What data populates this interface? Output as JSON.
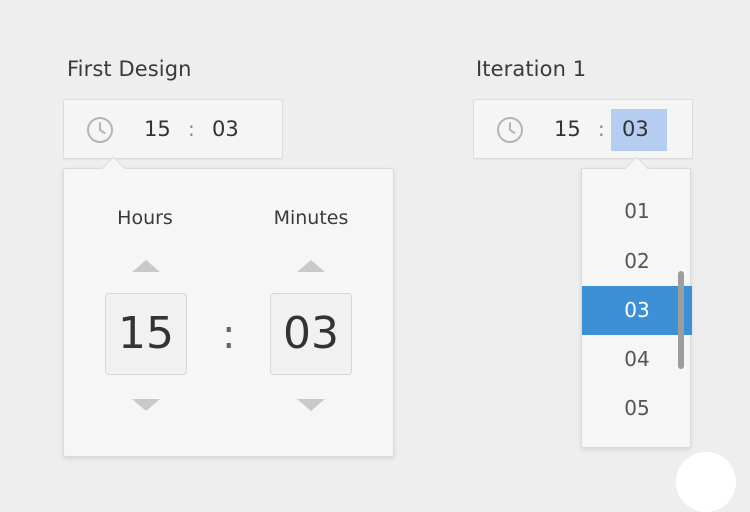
{
  "first_design": {
    "title": "First Design",
    "field": {
      "hours": "15",
      "separator": ":",
      "minutes": "03"
    },
    "picker": {
      "hours_label": "Hours",
      "minutes_label": "Minutes",
      "hours_value": "15",
      "separator": ":",
      "minutes_value": "03"
    }
  },
  "iteration_1": {
    "title": "Iteration 1",
    "field": {
      "hours": "15",
      "separator": ":",
      "minutes": "03"
    },
    "dropdown": {
      "options": [
        "01",
        "02",
        "03",
        "04",
        "05"
      ],
      "selected": "03"
    }
  },
  "colors": {
    "background": "#eeeeee",
    "selected_item": "#3d8fd6",
    "minutes_highlight": "#b4cdf0",
    "arrow": "#c9c9c9"
  },
  "icons": [
    "clock-icon",
    "up-arrow-icon",
    "down-arrow-icon"
  ]
}
